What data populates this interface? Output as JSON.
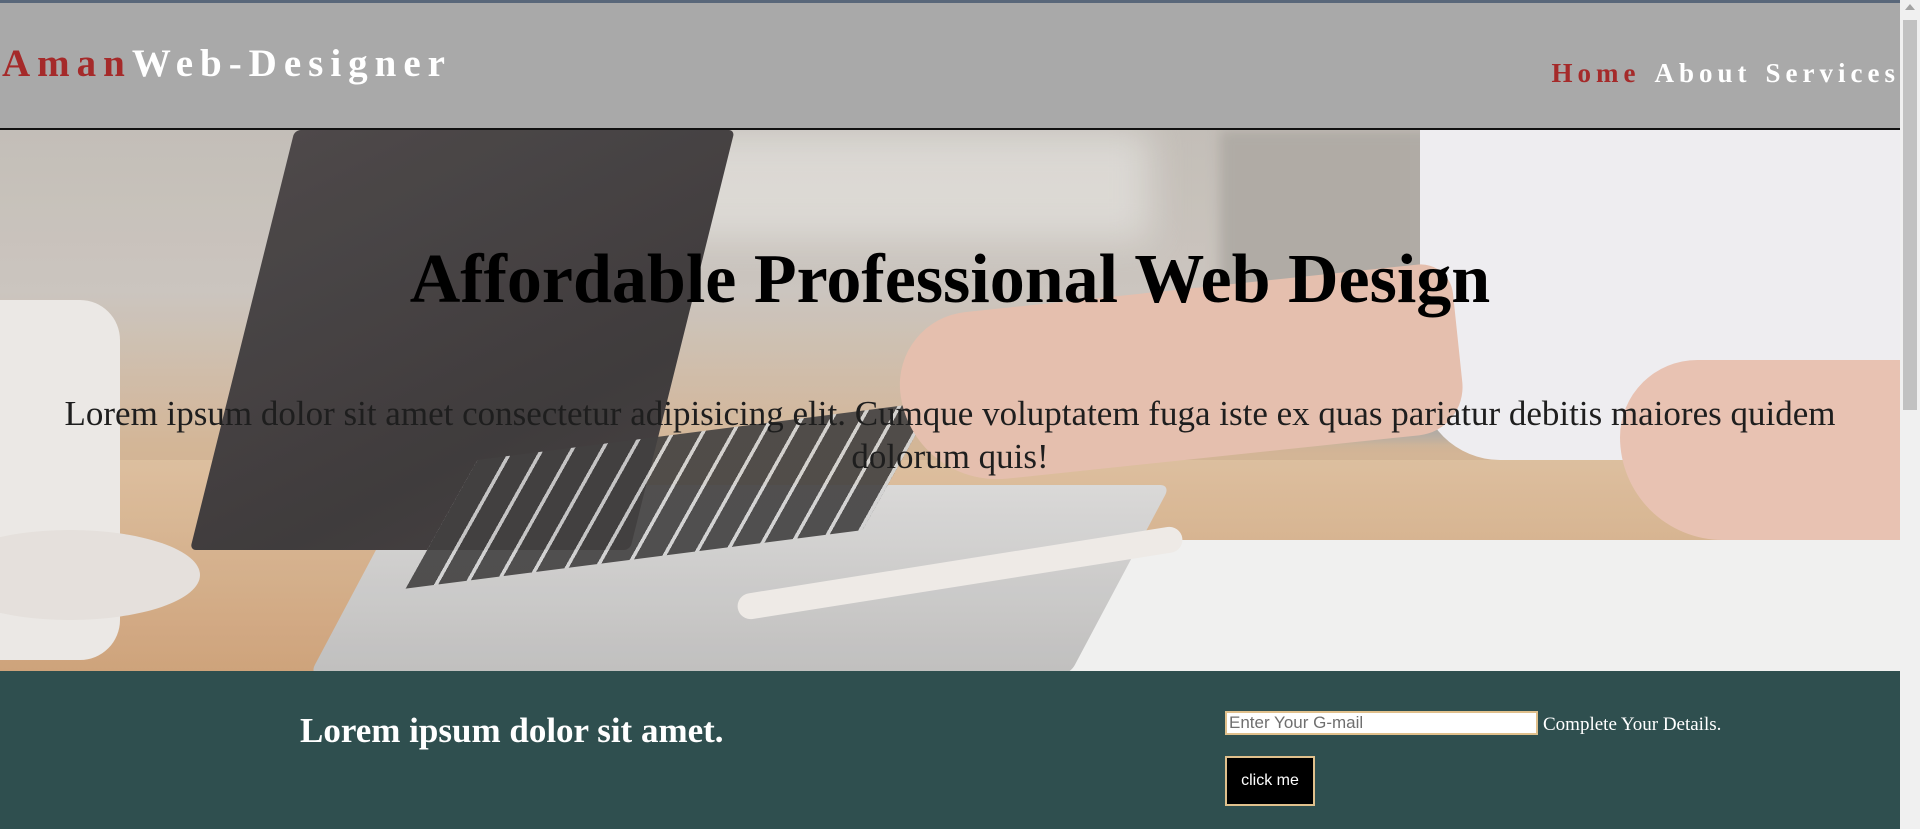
{
  "header": {
    "logo_accent": "Aman",
    "logo_rest": "Web-Designer",
    "nav": [
      {
        "label": "Home"
      },
      {
        "label": "About"
      },
      {
        "label": "Services"
      }
    ]
  },
  "hero": {
    "title": "Affordable Professional Web Design",
    "text": "Lorem ipsum dolor sit amet consectetur adipisicing elit. Cumque voluptatem fuga iste ex quas pariatur debitis maiores quidem dolorum quis!"
  },
  "band": {
    "heading": "Lorem ipsum dolor sit amet.",
    "email_placeholder": "Enter Your G-mail",
    "email_value": "",
    "details_label": "Complete Your Details.",
    "button_label": "click me"
  },
  "colors": {
    "header_bg": "#a9a9a9",
    "accent": "#a52a2a",
    "band_bg": "#2f4f4f",
    "button_border": "#e0c08c"
  }
}
